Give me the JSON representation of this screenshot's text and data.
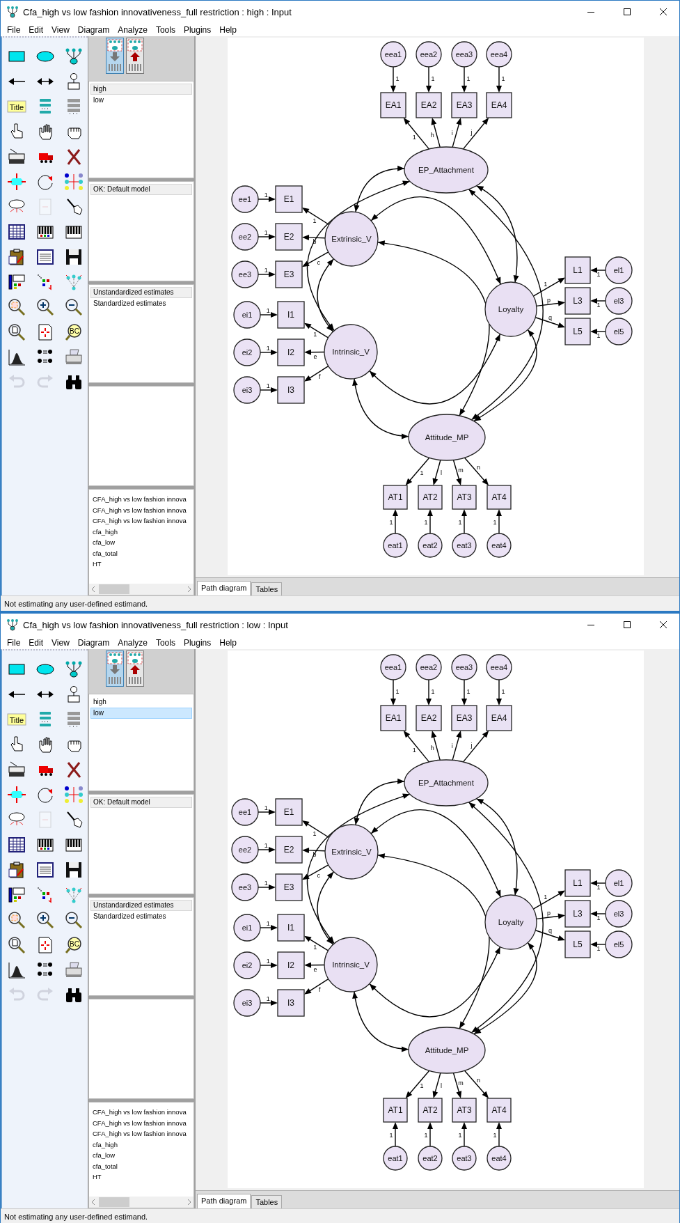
{
  "windows": [
    {
      "title": "Cfa_high vs low fashion innovativeness_full restriction : high : Input",
      "menu": [
        "File",
        "Edit",
        "View",
        "Diagram",
        "Analyze",
        "Tools",
        "Plugins",
        "Help"
      ],
      "tools": [
        {
          "disabled": false
        },
        {
          "disabled": false
        },
        {
          "disabled": false
        },
        {
          "disabled": false
        },
        {
          "disabled": false
        },
        {
          "disabled": false
        },
        {
          "disabled": false,
          "label": "Title"
        },
        {
          "disabled": false
        },
        {
          "disabled": false
        },
        {
          "disabled": false
        },
        {
          "disabled": false
        },
        {
          "disabled": false
        },
        {
          "disabled": false
        },
        {
          "disabled": false
        },
        {
          "disabled": false
        },
        {
          "disabled": false
        },
        {
          "disabled": false
        },
        {
          "disabled": false
        },
        {
          "disabled": false
        },
        {
          "disabled": true
        },
        {
          "disabled": false
        },
        {
          "disabled": false
        },
        {
          "disabled": false
        },
        {
          "disabled": false
        },
        {
          "disabled": false
        },
        {
          "disabled": false
        },
        {
          "disabled": false
        },
        {
          "disabled": false
        },
        {
          "disabled": false
        },
        {
          "disabled": false
        },
        {
          "disabled": false
        },
        {
          "disabled": false
        },
        {
          "disabled": false
        },
        {
          "disabled": false
        },
        {
          "disabled": false
        },
        {
          "disabled": false,
          "label": "BC"
        },
        {
          "disabled": false
        },
        {
          "disabled": false
        },
        {
          "disabled": false
        },
        {
          "disabled": true
        },
        {
          "disabled": true
        },
        {
          "disabled": false
        }
      ],
      "view_buttons": [
        {
          "selected": true
        },
        {
          "selected": false
        }
      ],
      "groups": {
        "focused": false,
        "items": [
          {
            "label": "high",
            "selected": true
          },
          {
            "label": "low",
            "selected": false
          }
        ]
      },
      "models": {
        "focused": false,
        "items": [
          {
            "label": "OK: Default model",
            "selected": true
          }
        ]
      },
      "estimates": {
        "focused": false,
        "items": [
          {
            "label": "Unstandardized estimates",
            "selected": true
          },
          {
            "label": "Standardized estimates",
            "selected": false
          }
        ]
      },
      "files": [
        "CFA_high vs low fashion innova",
        "CFA_high vs low fashion innova",
        "CFA_high vs low fashion innova",
        "cfa_high",
        "cfa_low",
        "cfa_total",
        "HT"
      ],
      "diagram": {
        "nodes": [
          {
            "kind": "error",
            "label": "eea1"
          },
          {
            "kind": "error",
            "label": "eea2"
          },
          {
            "kind": "error",
            "label": "eea3"
          },
          {
            "kind": "error",
            "label": "eea4"
          },
          {
            "kind": "observed",
            "label": "EA1"
          },
          {
            "kind": "observed",
            "label": "EA2"
          },
          {
            "kind": "observed",
            "label": "EA3"
          },
          {
            "kind": "observed",
            "label": "EA4"
          },
          {
            "kind": "latent",
            "label": "EP_Attachment"
          },
          {
            "kind": "error",
            "label": "ee1"
          },
          {
            "kind": "error",
            "label": "ee2"
          },
          {
            "kind": "error",
            "label": "ee3"
          },
          {
            "kind": "observed",
            "label": "E1"
          },
          {
            "kind": "observed",
            "label": "E2"
          },
          {
            "kind": "observed",
            "label": "E3"
          },
          {
            "kind": "latent",
            "label": "Extrinsic_V"
          },
          {
            "kind": "error",
            "label": "ei1"
          },
          {
            "kind": "error",
            "label": "ei2"
          },
          {
            "kind": "error",
            "label": "ei3"
          },
          {
            "kind": "observed",
            "label": "I1"
          },
          {
            "kind": "observed",
            "label": "I2"
          },
          {
            "kind": "observed",
            "label": "I3"
          },
          {
            "kind": "latent",
            "label": "Intrinsic_V"
          },
          {
            "kind": "latent",
            "label": "Loyalty"
          },
          {
            "kind": "observed",
            "label": "L1"
          },
          {
            "kind": "observed",
            "label": "L3"
          },
          {
            "kind": "observed",
            "label": "L5"
          },
          {
            "kind": "error",
            "label": "el1"
          },
          {
            "kind": "error",
            "label": "el3"
          },
          {
            "kind": "error",
            "label": "el5"
          },
          {
            "kind": "latent",
            "label": "Attitude_MP"
          },
          {
            "kind": "observed",
            "label": "AT1"
          },
          {
            "kind": "observed",
            "label": "AT2"
          },
          {
            "kind": "observed",
            "label": "AT3"
          },
          {
            "kind": "observed",
            "label": "AT4"
          },
          {
            "kind": "error",
            "label": "eat1"
          },
          {
            "kind": "error",
            "label": "eat2"
          },
          {
            "kind": "error",
            "label": "eat3"
          },
          {
            "kind": "error",
            "label": "eat4"
          }
        ],
        "path_labels": [
          "1",
          "1",
          "1",
          "1",
          "1",
          "h",
          "i",
          "j",
          "1",
          "1",
          "1",
          "1",
          "b",
          "c",
          "1",
          "1",
          "1",
          "1",
          "e",
          "f",
          "1",
          "p",
          "q",
          "1",
          "1",
          "1",
          "1",
          "l",
          "m",
          "n",
          "1",
          "1",
          "1",
          "1"
        ]
      },
      "tabs": [
        {
          "label": "Path diagram",
          "selected": true
        },
        {
          "label": "Tables",
          "selected": false
        }
      ],
      "status": "Not estimating any user-defined estimand."
    },
    {
      "title": "Cfa_high vs low fashion innovativeness_full restriction : low : Input",
      "menu": [
        "File",
        "Edit",
        "View",
        "Diagram",
        "Analyze",
        "Tools",
        "Plugins",
        "Help"
      ],
      "tools": [
        {
          "disabled": false
        },
        {
          "disabled": false
        },
        {
          "disabled": false
        },
        {
          "disabled": false
        },
        {
          "disabled": false
        },
        {
          "disabled": false
        },
        {
          "disabled": false,
          "label": "Title"
        },
        {
          "disabled": false
        },
        {
          "disabled": false
        },
        {
          "disabled": false
        },
        {
          "disabled": false
        },
        {
          "disabled": false
        },
        {
          "disabled": false
        },
        {
          "disabled": false
        },
        {
          "disabled": false
        },
        {
          "disabled": false
        },
        {
          "disabled": false
        },
        {
          "disabled": false
        },
        {
          "disabled": false
        },
        {
          "disabled": true
        },
        {
          "disabled": false
        },
        {
          "disabled": false
        },
        {
          "disabled": false
        },
        {
          "disabled": false
        },
        {
          "disabled": false
        },
        {
          "disabled": false
        },
        {
          "disabled": false
        },
        {
          "disabled": false
        },
        {
          "disabled": false
        },
        {
          "disabled": false
        },
        {
          "disabled": false
        },
        {
          "disabled": false
        },
        {
          "disabled": false
        },
        {
          "disabled": false
        },
        {
          "disabled": false
        },
        {
          "disabled": false,
          "label": "BC"
        },
        {
          "disabled": false
        },
        {
          "disabled": false
        },
        {
          "disabled": false
        },
        {
          "disabled": true
        },
        {
          "disabled": true
        },
        {
          "disabled": false
        }
      ],
      "view_buttons": [
        {
          "selected": true
        },
        {
          "selected": false
        }
      ],
      "groups": {
        "focused": true,
        "items": [
          {
            "label": "high",
            "selected": false
          },
          {
            "label": "low",
            "selected": true
          }
        ]
      },
      "models": {
        "focused": false,
        "items": [
          {
            "label": "OK: Default model",
            "selected": true
          }
        ]
      },
      "estimates": {
        "focused": false,
        "items": [
          {
            "label": "Unstandardized estimates",
            "selected": true
          },
          {
            "label": "Standardized estimates",
            "selected": false
          }
        ]
      },
      "files": [
        "CFA_high vs low fashion innova",
        "CFA_high vs low fashion innova",
        "CFA_high vs low fashion innova",
        "cfa_high",
        "cfa_low",
        "cfa_total",
        "HT"
      ],
      "diagram": {
        "nodes": [
          {
            "kind": "error",
            "label": "eea1"
          },
          {
            "kind": "error",
            "label": "eea2"
          },
          {
            "kind": "error",
            "label": "eea3"
          },
          {
            "kind": "error",
            "label": "eea4"
          },
          {
            "kind": "observed",
            "label": "EA1"
          },
          {
            "kind": "observed",
            "label": "EA2"
          },
          {
            "kind": "observed",
            "label": "EA3"
          },
          {
            "kind": "observed",
            "label": "EA4"
          },
          {
            "kind": "latent",
            "label": "EP_Attachment"
          },
          {
            "kind": "error",
            "label": "ee1"
          },
          {
            "kind": "error",
            "label": "ee2"
          },
          {
            "kind": "error",
            "label": "ee3"
          },
          {
            "kind": "observed",
            "label": "E1"
          },
          {
            "kind": "observed",
            "label": "E2"
          },
          {
            "kind": "observed",
            "label": "E3"
          },
          {
            "kind": "latent",
            "label": "Extrinsic_V"
          },
          {
            "kind": "error",
            "label": "ei1"
          },
          {
            "kind": "error",
            "label": "ei2"
          },
          {
            "kind": "error",
            "label": "ei3"
          },
          {
            "kind": "observed",
            "label": "I1"
          },
          {
            "kind": "observed",
            "label": "I2"
          },
          {
            "kind": "observed",
            "label": "I3"
          },
          {
            "kind": "latent",
            "label": "Intrinsic_V"
          },
          {
            "kind": "latent",
            "label": "Loyalty"
          },
          {
            "kind": "observed",
            "label": "L1"
          },
          {
            "kind": "observed",
            "label": "L3"
          },
          {
            "kind": "observed",
            "label": "L5"
          },
          {
            "kind": "error",
            "label": "el1"
          },
          {
            "kind": "error",
            "label": "el3"
          },
          {
            "kind": "error",
            "label": "el5"
          },
          {
            "kind": "latent",
            "label": "Attitude_MP"
          },
          {
            "kind": "observed",
            "label": "AT1"
          },
          {
            "kind": "observed",
            "label": "AT2"
          },
          {
            "kind": "observed",
            "label": "AT3"
          },
          {
            "kind": "observed",
            "label": "AT4"
          },
          {
            "kind": "error",
            "label": "eat1"
          },
          {
            "kind": "error",
            "label": "eat2"
          },
          {
            "kind": "error",
            "label": "eat3"
          },
          {
            "kind": "error",
            "label": "eat4"
          }
        ],
        "path_labels": [
          "1",
          "1",
          "1",
          "1",
          "1",
          "h",
          "i",
          "j",
          "1",
          "1",
          "1",
          "1",
          "b",
          "c",
          "1",
          "1",
          "1",
          "1",
          "e",
          "f",
          "1",
          "p",
          "q",
          "1",
          "1",
          "1",
          "1",
          "l",
          "m",
          "n",
          "1",
          "1",
          "1",
          "1"
        ]
      },
      "tabs": [
        {
          "label": "Path diagram",
          "selected": true
        },
        {
          "label": "Tables",
          "selected": false
        }
      ],
      "status": "Not estimating any user-defined estimand."
    }
  ]
}
